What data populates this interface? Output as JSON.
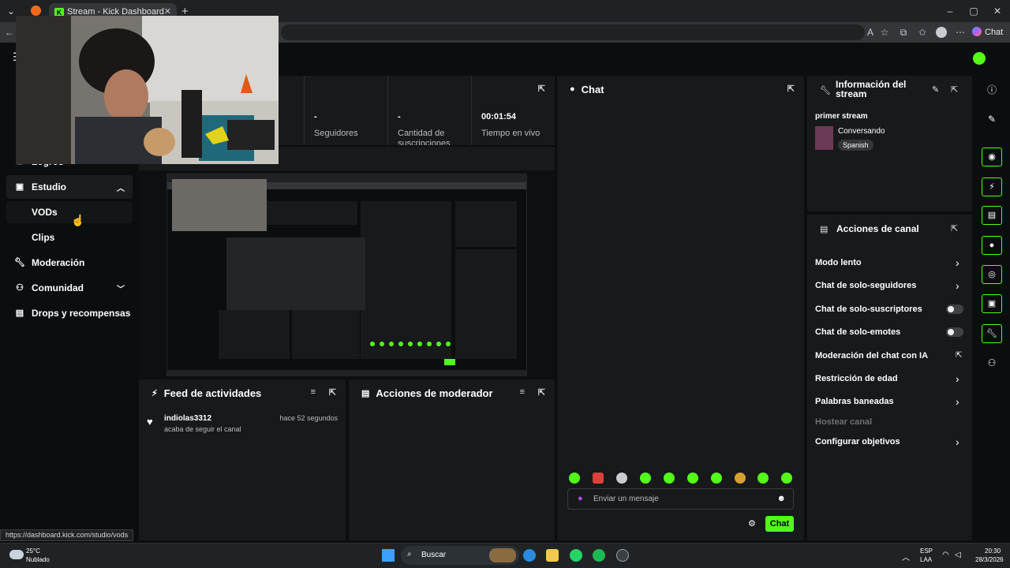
{
  "browser": {
    "tab_title": "Stream - Kick Dashboard",
    "chat_button": "Chat"
  },
  "sidebar": {
    "items": [
      {
        "label": "Logros"
      },
      {
        "label": "Estudio"
      },
      {
        "label": "VODs"
      },
      {
        "label": "Clips"
      },
      {
        "label": "Moderación"
      },
      {
        "label": "Comunidad"
      },
      {
        "label": "Drops y recompensas"
      }
    ]
  },
  "stats": [
    {
      "value": "-",
      "label": "Seguidores"
    },
    {
      "value": "-",
      "label": "Cantidad de suscripciones"
    },
    {
      "value": "00:01:54",
      "label": "Tiempo en vivo"
    }
  ],
  "chat": {
    "title": "Chat",
    "placeholder": "Enviar un mensaje",
    "send_label": "Chat"
  },
  "stream_info": {
    "title": "Información del stream",
    "stream_title": "primer stream",
    "category": "Conversando",
    "language": "Spanish"
  },
  "channel_actions": {
    "title": "Acciones de canal",
    "items": [
      {
        "label": "Modo lento"
      },
      {
        "label": "Chat de solo-seguidores"
      },
      {
        "label": "Chat de solo-suscriptores"
      },
      {
        "label": "Chat de solo-emotes"
      },
      {
        "label": "Moderación del chat con IA"
      },
      {
        "label": "Restricción de edad"
      },
      {
        "label": "Palabras baneadas"
      },
      {
        "label": "Hostear canal"
      },
      {
        "label": "Configurar objetivos"
      }
    ]
  },
  "activity_feed": {
    "title": "Feed de actividades",
    "events": [
      {
        "user": "indiolas3312",
        "time": "hace 52 segundos",
        "text": "acaba de seguir el canal"
      }
    ]
  },
  "mod_actions": {
    "title": "Acciones de moderador"
  },
  "status_url": "https://dashboard.kick.com/studio/vods",
  "taskbar": {
    "weather_temp": "25°C",
    "weather_text": "Nublado",
    "search_label": "Buscar",
    "lang1": "ESP",
    "lang2": "LAA",
    "time": "20:30",
    "date": "28/3/2026"
  }
}
